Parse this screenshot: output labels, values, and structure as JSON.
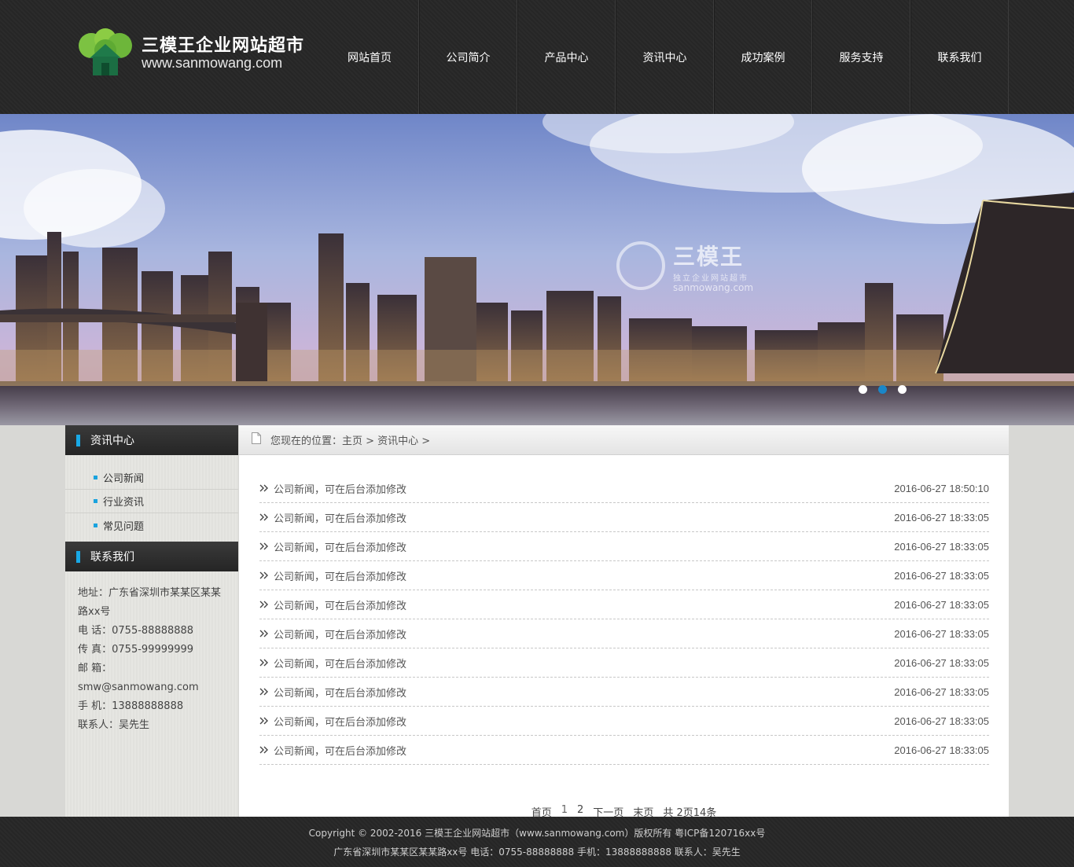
{
  "header": {
    "logo_title": "三模王企业网站超市",
    "logo_url": "www.sanmowang.com",
    "nav": [
      "网站首页",
      "公司简介",
      "产品中心",
      "资讯中心",
      "成功案例",
      "服务支持",
      "联系我们"
    ]
  },
  "banner": {
    "watermark_title": "三模王",
    "watermark_sub": "独立企业网站超市",
    "watermark_url": "sanmowang.com",
    "slides": 3,
    "active_slide": 2
  },
  "sidebar": {
    "news_title": "资讯中心",
    "news_items": [
      "公司新闻",
      "行业资讯",
      "常见问题"
    ],
    "contact_title": "联系我们",
    "contact_lines": [
      "地址：广东省深圳市某某区某某路xx号",
      "电 话：0755-88888888",
      "传 真：0755-99999999",
      "邮 箱：smw@sanmowang.com",
      "手 机：13888888888",
      "联系人：吴先生"
    ]
  },
  "main": {
    "breadcrumb": "您现在的位置：主页 > 资讯中心 >",
    "news": [
      {
        "title": "公司新闻，可在后台添加修改",
        "date": "2016-06-27 18:50:10"
      },
      {
        "title": "公司新闻，可在后台添加修改",
        "date": "2016-06-27 18:33:05"
      },
      {
        "title": "公司新闻，可在后台添加修改",
        "date": "2016-06-27 18:33:05"
      },
      {
        "title": "公司新闻，可在后台添加修改",
        "date": "2016-06-27 18:33:05"
      },
      {
        "title": "公司新闻，可在后台添加修改",
        "date": "2016-06-27 18:33:05"
      },
      {
        "title": "公司新闻，可在后台添加修改",
        "date": "2016-06-27 18:33:05"
      },
      {
        "title": "公司新闻，可在后台添加修改",
        "date": "2016-06-27 18:33:05"
      },
      {
        "title": "公司新闻，可在后台添加修改",
        "date": "2016-06-27 18:33:05"
      },
      {
        "title": "公司新闻，可在后台添加修改",
        "date": "2016-06-27 18:33:05"
      },
      {
        "title": "公司新闻，可在后台添加修改",
        "date": "2016-06-27 18:33:05"
      }
    ],
    "pager": {
      "first": "首页",
      "pages": [
        "1",
        "2"
      ],
      "next": "下一页",
      "last": "末页",
      "summary": "共 2页14条"
    }
  },
  "footer": {
    "line1": "Copyright © 2002-2016 三模王企业网站超市（www.sanmowang.com）版权所有 粤ICP备120716xx号",
    "line2": "广东省深圳市某某区某某路xx号 电话：0755-88888888   手机：13888888888   联系人：吴先生"
  },
  "colors": {
    "accent": "#19a9e6",
    "header_bg": "#2b2b2b",
    "logo_green": "#6cbf3c"
  }
}
